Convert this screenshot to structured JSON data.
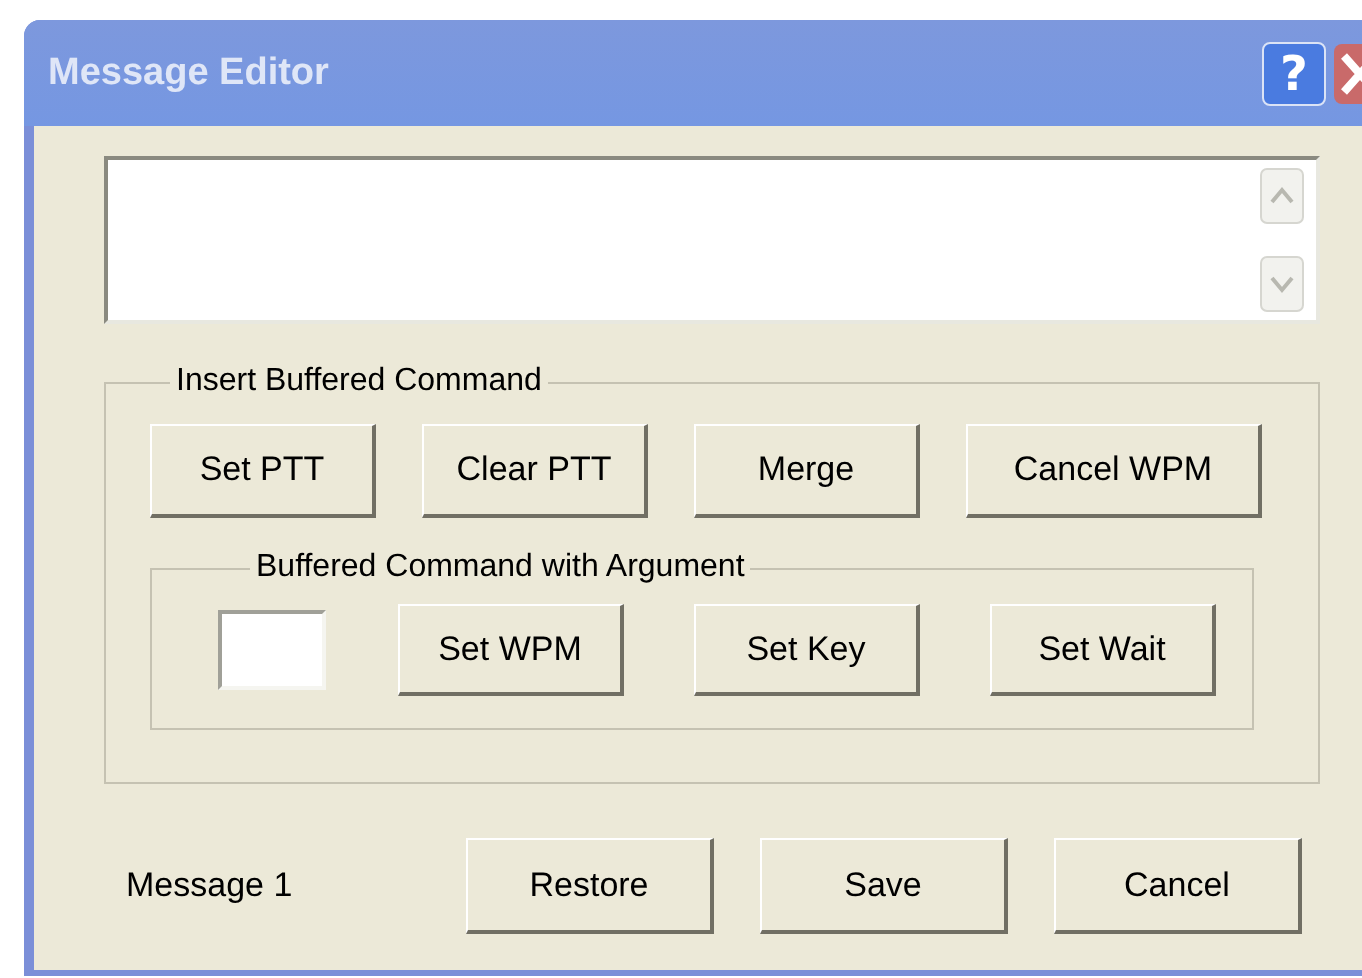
{
  "window": {
    "title": "Message Editor",
    "help_button": "?"
  },
  "insert_group": {
    "legend": "Insert Buffered Command",
    "buttons": [
      "Set PTT",
      "Clear PTT",
      "Merge",
      "Cancel WPM"
    ]
  },
  "argument_group": {
    "legend": "Buffered Command with Argument",
    "buttons": [
      "Set WPM",
      "Set Key",
      "Set Wait"
    ]
  },
  "footer": {
    "label": "Message 1",
    "buttons": [
      "Restore",
      "Save",
      "Cancel"
    ]
  }
}
